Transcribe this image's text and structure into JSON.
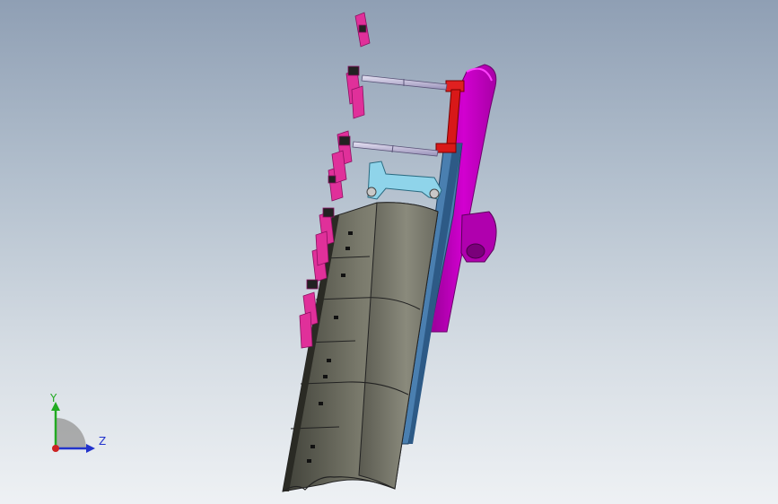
{
  "viewport": {
    "background_top": "#8f9fb4",
    "background_bottom": "#eef1f4",
    "model": {
      "base_plate_color": "#c600c6",
      "slide_plate_color": "#4a7fb0",
      "bracket_color": "#8fd4ea",
      "cylinder_color": "#d81818",
      "guide_rod_color": "#c7bfe0",
      "blade_color": "#6e6e62",
      "tooth_color": "#e0309a"
    }
  },
  "triad": {
    "y_label": "Y",
    "z_label": "Z",
    "y_color": "#22aa22",
    "z_color": "#2233cc",
    "origin_color": "#cc2222"
  }
}
